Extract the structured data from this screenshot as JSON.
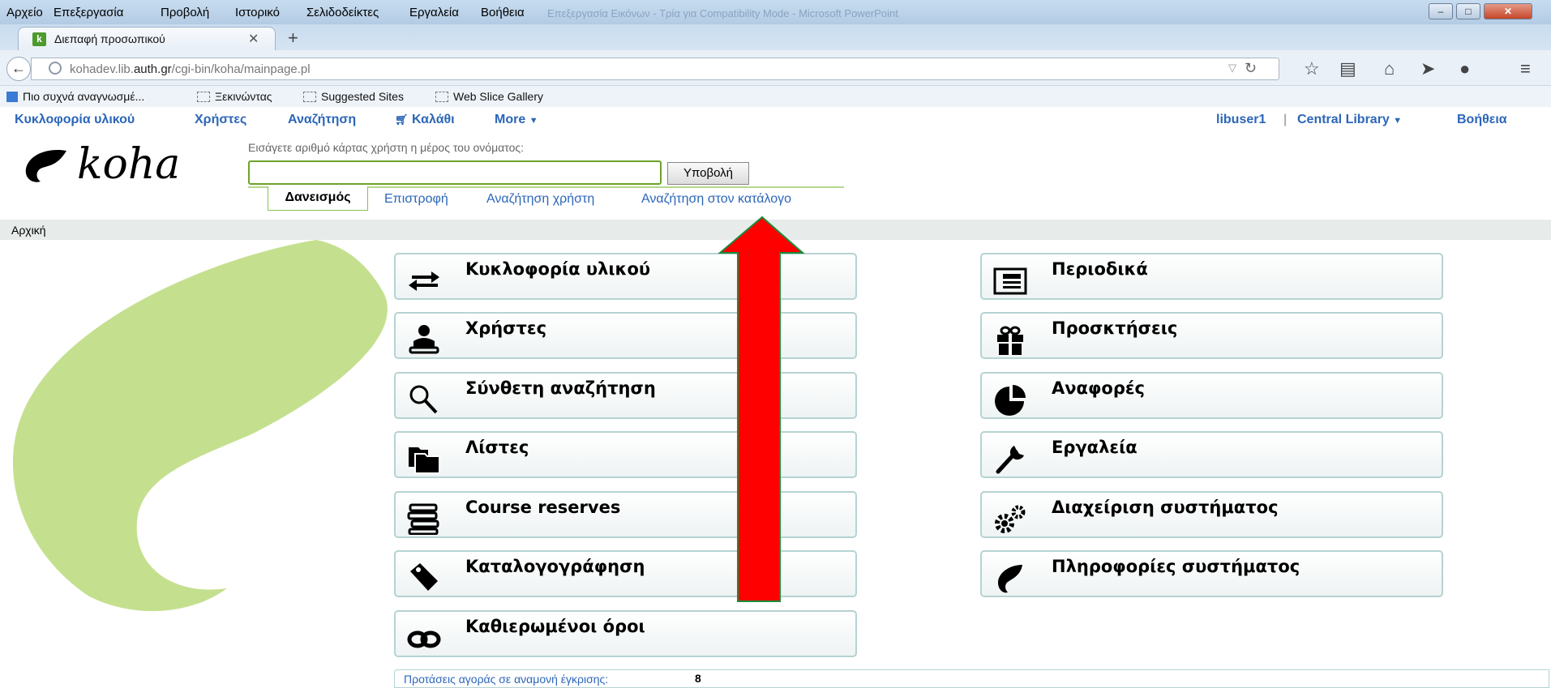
{
  "window": {
    "menu": [
      "Αρχείο",
      "Επεξεργασία",
      "Προβολή",
      "Ιστορικό",
      "Σελιδοδείκτες",
      "Εργαλεία",
      "Βοήθεια"
    ],
    "faded_title": "Επεξεργασία Εικόνων - Τρία για Compatibility Mode - Microsoft PowerPoint"
  },
  "tab": {
    "title": "Διεπαφή προσωπικού",
    "favicon": "k"
  },
  "address": {
    "url_pre": "kohadev.lib.",
    "url_host": "auth.gr",
    "url_post": "/cgi-bin/koha/mainpage.pl"
  },
  "bookmarks": [
    "Πιο συχνά αναγνωσμέ...",
    "Ξεκινώντας",
    "Suggested Sites",
    "Web Slice Gallery"
  ],
  "koha_nav": {
    "circulation": "Κυκλοφορία υλικού",
    "patrons": "Χρήστες",
    "search": "Αναζήτηση",
    "cart": "Καλάθι",
    "more": "More",
    "user": "libuser1",
    "separator": "|",
    "library": "Central Library",
    "help": "Βοήθεια"
  },
  "header": {
    "logo_text": "koha",
    "search_label": "Εισάγετε αριθμό κάρτας χρήστη η μέρος του ονόματος:",
    "search_value": "",
    "submit": "Υποβολή",
    "tabs": [
      "Δανεισμός",
      "Επιστροφή",
      "Αναζήτηση χρήστη",
      "Αναζήτηση στον κατάλογο"
    ]
  },
  "breadcrumb": "Αρχική",
  "modules_left": [
    {
      "label": "Κυκλοφορία υλικού",
      "icon": "circulation-arrows-icon"
    },
    {
      "label": "Χρήστες",
      "icon": "patron-icon"
    },
    {
      "label": "Σύνθετη αναζήτηση",
      "icon": "magnifier-icon"
    },
    {
      "label": "Λίστες",
      "icon": "folders-icon"
    },
    {
      "label": "Course reserves",
      "icon": "books-stack-icon"
    },
    {
      "label": "Καταλογογράφηση",
      "icon": "tag-icon"
    },
    {
      "label": "Καθιερωμένοι όροι",
      "icon": "chain-link-icon"
    }
  ],
  "modules_right": [
    {
      "label": "Περιοδικά",
      "icon": "newspaper-icon"
    },
    {
      "label": "Προσκτήσεις",
      "icon": "gift-icon"
    },
    {
      "label": "Αναφορές",
      "icon": "pie-chart-icon"
    },
    {
      "label": "Εργαλεία",
      "icon": "wrench-icon"
    },
    {
      "label": "Διαχείριση συστήματος",
      "icon": "gears-icon"
    },
    {
      "label": "Πληροφορίες συστήματος",
      "icon": "koha-leaf-icon"
    }
  ],
  "pending": {
    "text": "Προτάσεις αγοράς σε αναμονή έγκρισης:",
    "count": "8"
  },
  "colors": {
    "link": "#2c66b8",
    "koha_green": "#c4e08f",
    "arrow_red": "#ff0000"
  }
}
